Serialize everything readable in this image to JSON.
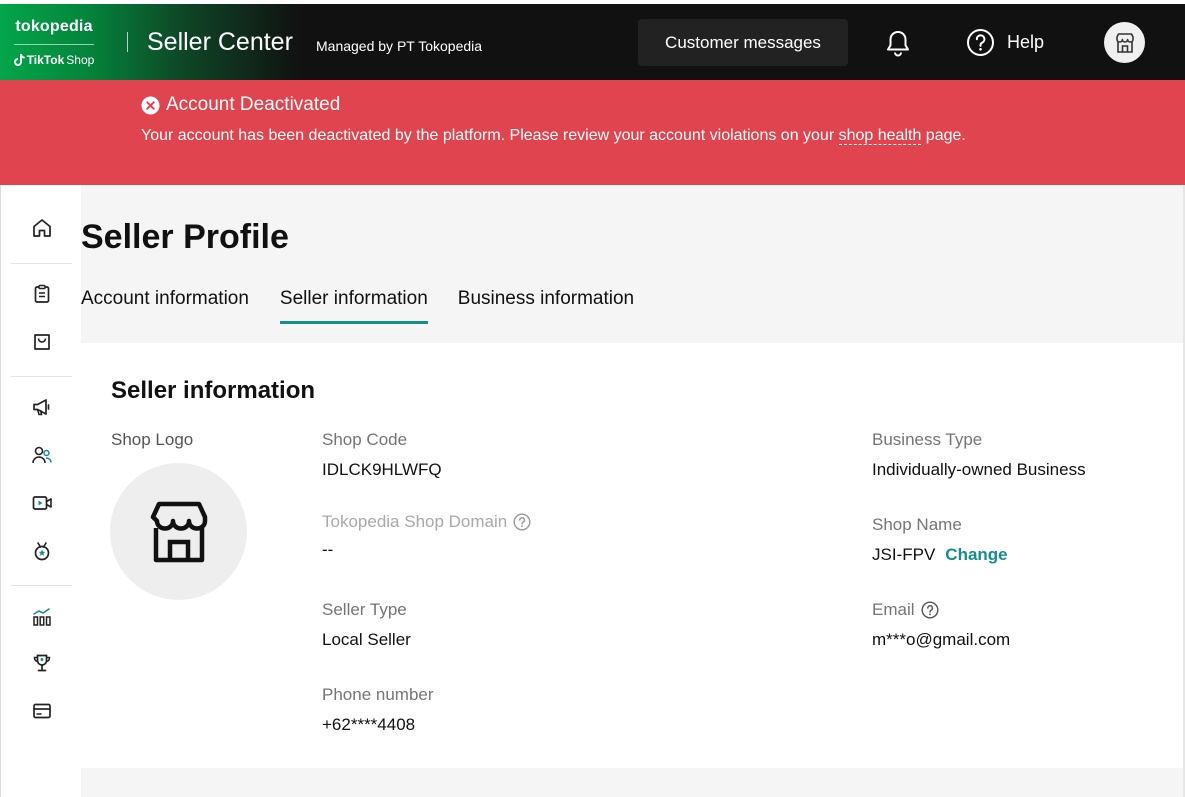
{
  "header": {
    "brand_tokopedia": "tokopedia",
    "brand_tiktok": "TikTok",
    "brand_shop": "Shop",
    "title": "Seller Center",
    "managed_by": "Managed by PT Tokopedia",
    "customer_messages": "Customer messages",
    "help": "Help"
  },
  "alert": {
    "title": "Account Deactivated",
    "message_before": "Your account has been deactivated by the platform. Please review your account violations on your ",
    "link": "shop health",
    "message_after": " page."
  },
  "sidebar": {
    "icons": [
      "home-icon",
      "orders-icon",
      "products-icon",
      "marketing-icon",
      "customers-icon",
      "live-video-icon",
      "rewards-icon",
      "analytics-icon",
      "trophy-icon",
      "finance-icon"
    ]
  },
  "page": {
    "title": "Seller Profile",
    "tabs": [
      "Account information",
      "Seller information",
      "Business information"
    ],
    "active_tab": "Seller information"
  },
  "seller_info": {
    "section_title": "Seller information",
    "shop_logo_label": "Shop Logo",
    "shop_code_label": "Shop Code",
    "shop_code": "IDLCK9HLWFQ",
    "domain_label": "Tokopedia Shop Domain",
    "domain_value": "--",
    "seller_type_label": "Seller Type",
    "seller_type": "Local Seller",
    "phone_label": "Phone number",
    "phone": "+62****4408",
    "business_type_label": "Business Type",
    "business_type": "Individually-owned Business",
    "shop_name_label": "Shop Name",
    "shop_name": "JSI-FPV",
    "change_label": "Change",
    "email_label": "Email",
    "email": "m***o@gmail.com"
  },
  "colors": {
    "accent": "#14908c",
    "alert": "#e0444e",
    "topbar": "#111111",
    "brand_green": "#03a64a"
  }
}
